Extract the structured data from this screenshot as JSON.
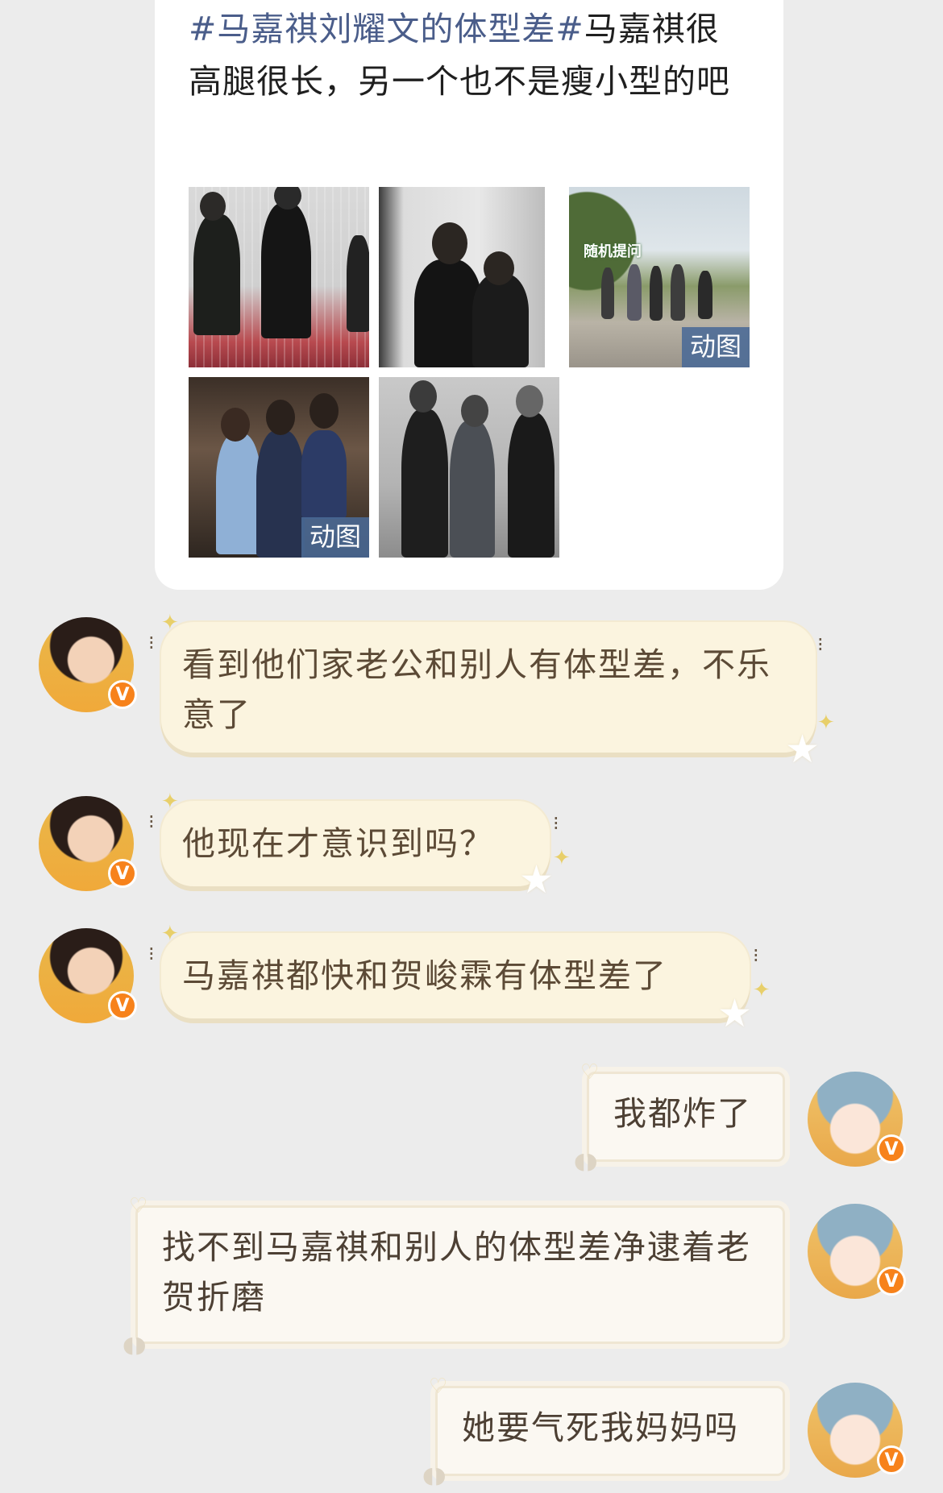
{
  "post": {
    "hashtag": "#马嘉祺刘耀文的体型差#",
    "text": "马嘉祺很高腿很长，另一个也不是瘦小型的吧",
    "images": [
      {
        "gif": false
      },
      {
        "gif": false
      },
      {
        "gif": true,
        "badge": "动图",
        "overlay_text": "随机提问"
      },
      {
        "gif": true,
        "badge": "动图"
      },
      {
        "gif": false
      }
    ]
  },
  "messages": [
    {
      "side": "left",
      "text": "看到他们家老公和别人有体型差，不乐意了",
      "badge": "V"
    },
    {
      "side": "left",
      "text": "他现在才意识到吗？",
      "badge": "V"
    },
    {
      "side": "left",
      "text": "马嘉祺都快和贺峻霖有体型差了",
      "badge": "V"
    },
    {
      "side": "right",
      "text": "我都炸了",
      "badge": "V"
    },
    {
      "side": "right",
      "text": "找不到马嘉祺和别人的体型差净逮着老贺折磨",
      "badge": "V"
    },
    {
      "side": "right",
      "text": "她要气死我妈妈吗",
      "badge": "V"
    }
  ],
  "colors": {
    "background": "#ececec",
    "hashtag": "#4a5d8a",
    "left_bubble": "#fbf4df",
    "right_bubble": "#fbf8f2",
    "verified_badge": "#f7821b"
  },
  "icons": [
    "verified-badge-icon",
    "sparkle-icon",
    "star-sticker-icon",
    "fish-icon",
    "heart-icon"
  ]
}
